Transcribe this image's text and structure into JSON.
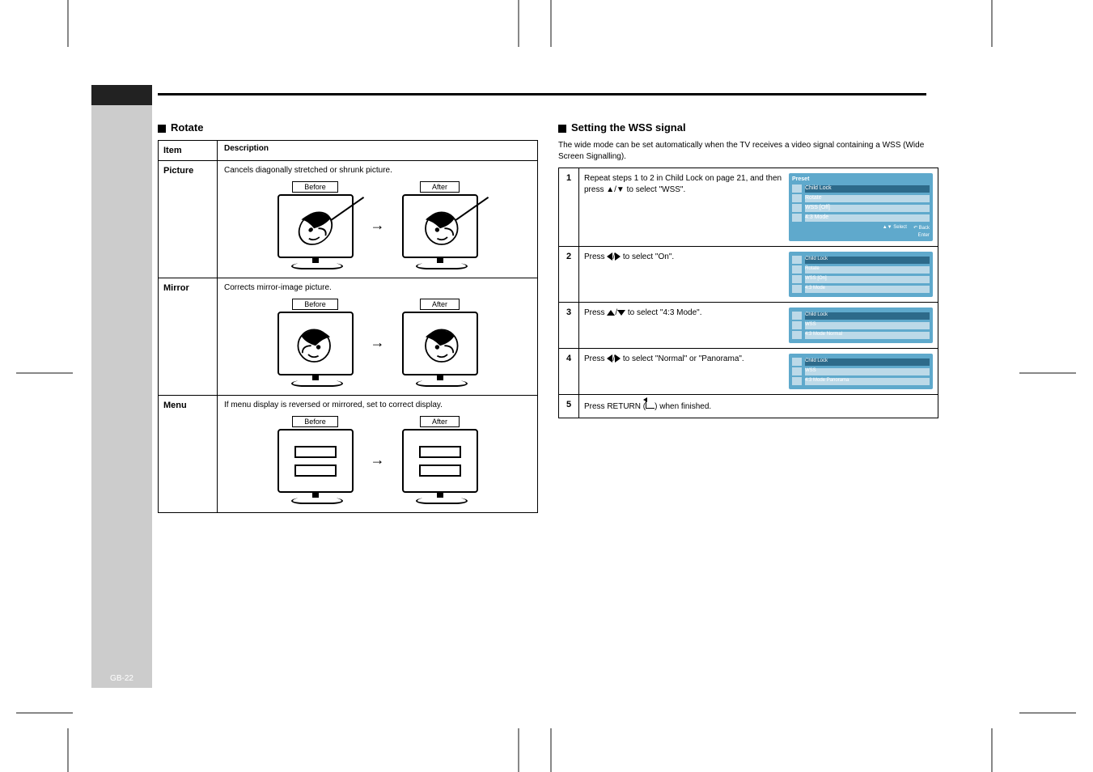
{
  "page_number": "GB-22",
  "left": {
    "title": "Rotate",
    "table_header": {
      "col1": "Item",
      "col2": "Description"
    },
    "rows": [
      {
        "name": "Picture",
        "desc": "Cancels diagonally stretched or shrunk picture.",
        "before": "Before",
        "after": "After"
      },
      {
        "name": "Mirror",
        "desc": "Corrects mirror-image picture.",
        "before": "Before",
        "after": "After"
      },
      {
        "name": "Menu",
        "desc": "If menu display is reversed or mirrored, set to correct display.",
        "before": "Before",
        "after": "After"
      }
    ]
  },
  "right": {
    "title": "Setting the WSS signal",
    "intro": "The wide mode can be set automatically when the TV receives a video signal containing a WSS (Wide Screen Signalling).",
    "steps": [
      {
        "num": "1",
        "text": "Repeat steps 1 to 2 in Child Lock on page 21, and then press ▲/▼ to select \"WSS\".",
        "osd": "full"
      },
      {
        "num": "2",
        "text": "Press ◄/► to select \"On\".",
        "osd": "half"
      },
      {
        "num": "3",
        "text": "Press ▲/▼ to select \"4:3 Mode\".",
        "osd": "half2"
      },
      {
        "num": "4",
        "text": "Press ◄/► to select \"Normal\" or \"Panorama\".",
        "osd": "half3"
      },
      {
        "num": "5",
        "text": "Press RETURN (↩) when finished."
      }
    ],
    "osd": {
      "title": "Preset",
      "items": [
        "Child Lock",
        "Rotate",
        "WSS",
        "4:3 Mode"
      ],
      "wss_val": "[Off]",
      "wss_on": "[On]",
      "mode_items": [
        "Normal",
        "Panorama"
      ],
      "select_label": "Select",
      "back_label": "Back",
      "enter_label": "Enter"
    }
  }
}
